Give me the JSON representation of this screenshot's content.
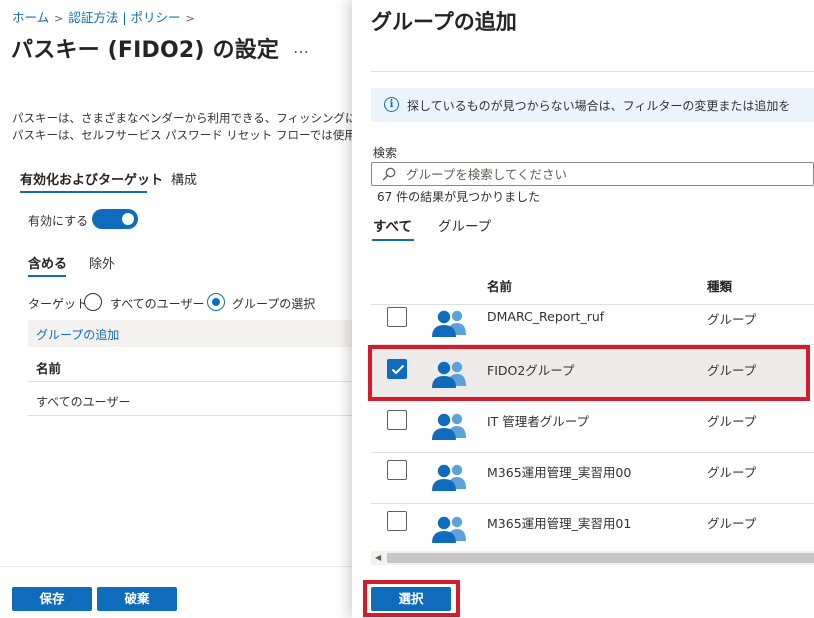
{
  "breadcrumb": {
    "items": [
      "ホーム",
      "認証方法 | ポリシー"
    ]
  },
  "page": {
    "title": "パスキー (FIDO2) の設定",
    "more": "…",
    "description_lines": [
      "パスキーは、さまざまなベンダーから利用できる、フィッシングに強い標準",
      "パスキーは、セルフサービス パスワード リセット フローでは使用できませ"
    ]
  },
  "main_tabs": [
    "有効化およびターゲット",
    "構成"
  ],
  "enable": {
    "label": "有効にする",
    "on": true
  },
  "sub_tabs": [
    "含める",
    "除外"
  ],
  "target": {
    "label": "ターゲット",
    "option_all": "すべてのユーザー",
    "option_groups": "グループの選択",
    "selected": "groups"
  },
  "left_table": {
    "add_group": "グループの追加",
    "header": "名前",
    "rows": [
      "すべてのユーザー"
    ]
  },
  "footer": {
    "save": "保存",
    "discard": "破棄"
  },
  "panel": {
    "title": "グループの追加",
    "info_text": "探しているものが見つからない場合は、フィルターの変更または追加を",
    "search_label": "検索",
    "search_placeholder": "グループを検索してください",
    "search_value": "",
    "result_count": "67 件の結果が見つかりました",
    "tabs": [
      "すべて",
      "グループ"
    ],
    "columns": {
      "name": "名前",
      "type": "種類"
    },
    "rows": [
      {
        "name": "DMARC_Report_ruf",
        "type": "グループ",
        "checked": false
      },
      {
        "name": "FIDO2グループ",
        "type": "グループ",
        "checked": true
      },
      {
        "name": "IT 管理者グループ",
        "type": "グループ",
        "checked": false
      },
      {
        "name": "M365運用管理_実習用00",
        "type": "グループ",
        "checked": false
      },
      {
        "name": "M365運用管理_実習用01",
        "type": "グループ",
        "checked": false
      }
    ],
    "select_button": "選択"
  },
  "colors": {
    "accent": "#0f6cbd",
    "highlight": "#d41c2c",
    "group_icon_front": "#0f6cbd",
    "group_icon_back": "#5ea0d8"
  },
  "icons": [
    "chevron-right-icon",
    "more-icon",
    "info-icon",
    "search-icon",
    "group-icon",
    "checkmark-icon",
    "scroll-left-icon"
  ]
}
